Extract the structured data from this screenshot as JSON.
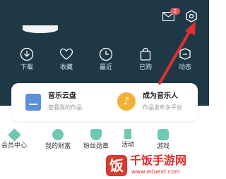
{
  "header": {
    "mail_badge": "2"
  },
  "nav": [
    {
      "label": "下载"
    },
    {
      "label": "收藏"
    },
    {
      "label": "最近"
    },
    {
      "label": "已购"
    },
    {
      "label": "动态"
    }
  ],
  "cards": {
    "cloud": {
      "title": "音乐云盘",
      "subtitle": "查看我的作品"
    },
    "musician": {
      "title": "成为音乐人",
      "subtitle": "作品发布多平台"
    }
  },
  "row2": [
    {
      "label": "会员中心"
    },
    {
      "label": "我的财富"
    },
    {
      "label": "粉丝勋章"
    },
    {
      "label": "活动"
    },
    {
      "label": "游戏"
    }
  ],
  "watermark": {
    "brand": "饭",
    "title": "千饭手游网",
    "url": "www.eduext.com"
  },
  "colors": {
    "header_bg": "#1f3845",
    "accent": "#6ec8b3",
    "arrow": "#e03030"
  }
}
